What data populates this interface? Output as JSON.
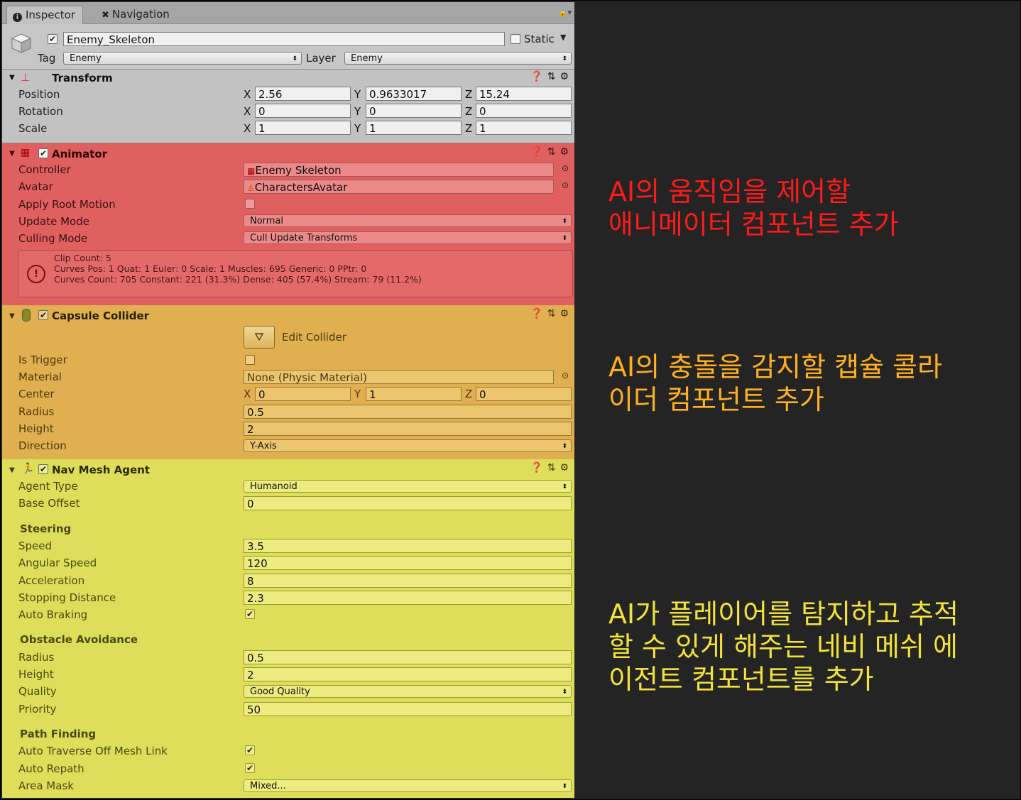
{
  "tabs": {
    "inspector": "Inspector",
    "navigation": "Navigation"
  },
  "header": {
    "object_name": "Enemy_Skeleton",
    "static_label": "Static",
    "tag_label": "Tag",
    "tag_value": "Enemy",
    "layer_label": "Layer",
    "layer_value": "Enemy"
  },
  "transform": {
    "title": "Transform",
    "position_label": "Position",
    "rotation_label": "Rotation",
    "scale_label": "Scale",
    "position": {
      "x": "2.56",
      "y": "0.9633017",
      "z": "15.24"
    },
    "rotation": {
      "x": "0",
      "y": "0",
      "z": "0"
    },
    "scale": {
      "x": "1",
      "y": "1",
      "z": "1"
    }
  },
  "animator": {
    "title": "Animator",
    "color": "#e06060",
    "controller_label": "Controller",
    "controller_value": "Enemy Skeleton",
    "avatar_label": "Avatar",
    "avatar_value": "CharactersAvatar",
    "apply_root_motion_label": "Apply Root Motion",
    "update_mode_label": "Update Mode",
    "update_mode_value": "Normal",
    "culling_mode_label": "Culling Mode",
    "culling_mode_value": "Cull Update Transforms",
    "info_line1": "Clip Count: 5",
    "info_line2": "Curves Pos: 1 Quat: 1 Euler: 0 Scale: 1 Muscles: 695 Generic: 0 PPtr: 0",
    "info_line3": "Curves Count: 705 Constant: 221 (31.3%) Dense: 405 (57.4%) Stream: 79 (11.2%)"
  },
  "capsule": {
    "title": "Capsule Collider",
    "color": "#e0b050",
    "edit_collider_label": "Edit Collider",
    "is_trigger_label": "Is Trigger",
    "material_label": "Material",
    "material_value": "None (Physic Material)",
    "center_label": "Center",
    "center": {
      "x": "0",
      "y": "1",
      "z": "0"
    },
    "radius_label": "Radius",
    "radius_value": "0.5",
    "height_label": "Height",
    "height_value": "2",
    "direction_label": "Direction",
    "direction_value": "Y-Axis"
  },
  "navmesh": {
    "title": "Nav Mesh Agent",
    "color": "#dede5a",
    "agent_type_label": "Agent Type",
    "agent_type_value": "Humanoid",
    "base_offset_label": "Base Offset",
    "base_offset_value": "0",
    "steering_header": "Steering",
    "speed_label": "Speed",
    "speed_value": "3.5",
    "angular_speed_label": "Angular Speed",
    "angular_speed_value": "120",
    "acceleration_label": "Acceleration",
    "acceleration_value": "8",
    "stopping_distance_label": "Stopping Distance",
    "stopping_distance_value": "2.3",
    "auto_braking_label": "Auto Braking",
    "obstacle_header": "Obstacle Avoidance",
    "radius_label": "Radius",
    "radius_value": "0.5",
    "height_label": "Height",
    "height_value": "2",
    "quality_label": "Quality",
    "quality_value": "Good Quality",
    "priority_label": "Priority",
    "priority_value": "50",
    "pathfinding_header": "Path Finding",
    "auto_traverse_label": "Auto Traverse Off Mesh Link",
    "auto_repath_label": "Auto Repath",
    "area_mask_label": "Area Mask",
    "area_mask_value": "Mixed..."
  },
  "annotations": {
    "animator_note": "AI의 움직임을 제어할\n애니메이터 컴포넌트 추가",
    "animator_color": "#ff1a1a",
    "capsule_note": "AI의 충돌을 감지할 캡슐 콜라\n이더 컴포넌트 추가",
    "capsule_color": "#ffb020",
    "navmesh_note": "AI가 플레이어를 탐지하고 추적\n할 수 있게 해주는 네비 메쉬 에\n이전트 컴포넌트를 추가",
    "navmesh_color": "#f2e23a"
  }
}
